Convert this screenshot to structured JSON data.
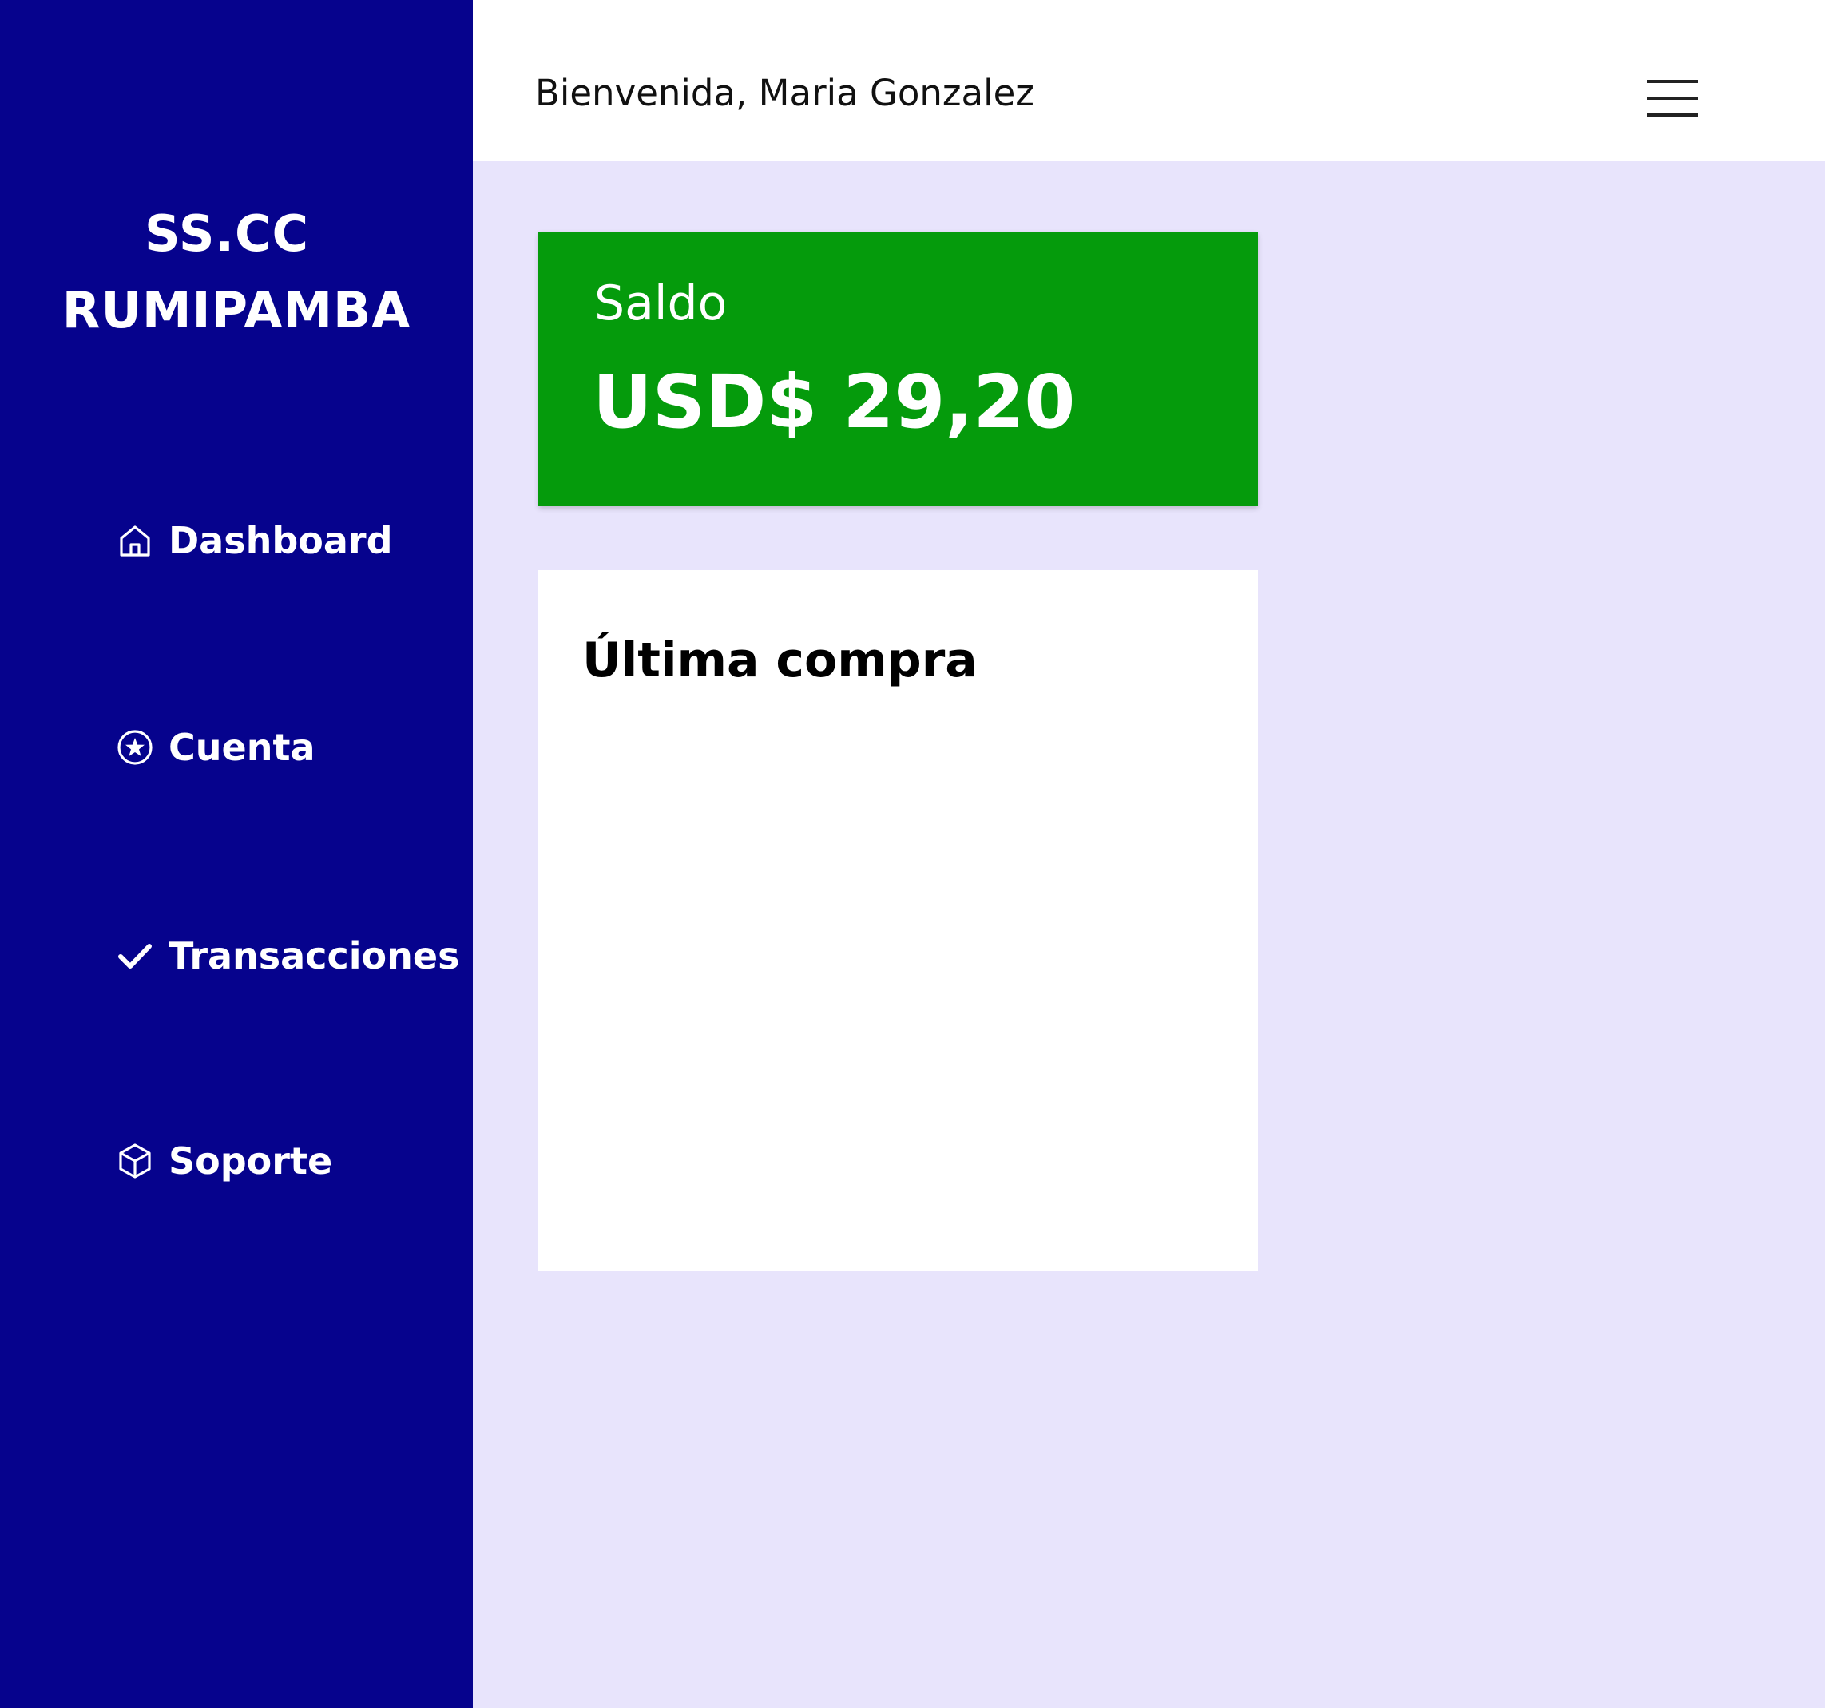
{
  "brand": {
    "line1": "SS.CC",
    "line2": "RUMIPAMBA"
  },
  "sidebar": {
    "items": [
      {
        "label": "Dashboard",
        "icon": "home-icon"
      },
      {
        "label": "Cuenta",
        "icon": "star-circle-icon"
      },
      {
        "label": "Transacciones",
        "icon": "check-icon"
      },
      {
        "label": "Soporte",
        "icon": "cube-icon"
      }
    ]
  },
  "header": {
    "welcome": "Bienvenida, Maria Gonzalez",
    "menu_icon": "hamburger-menu-icon"
  },
  "balance": {
    "label": "Saldo",
    "amount": "USD$ 29,20"
  },
  "last_purchase": {
    "title": "Última compra"
  },
  "colors": {
    "sidebar": "#06038d",
    "background": "#e8e4fc",
    "balance_card": "#059b0c",
    "topbar": "#ffffff"
  }
}
